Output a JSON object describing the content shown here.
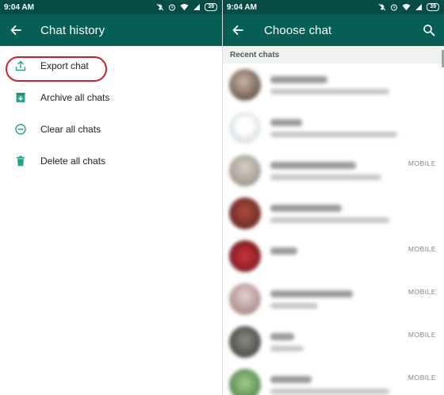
{
  "status_bar": {
    "time": "9:04 AM",
    "battery": "39"
  },
  "left": {
    "title": "Chat history",
    "menu": [
      {
        "label": "Export chat",
        "icon": "export-icon"
      },
      {
        "label": "Archive all chats",
        "icon": "archive-icon"
      },
      {
        "label": "Clear all chats",
        "icon": "clear-icon"
      },
      {
        "label": "Delete all chats",
        "icon": "delete-icon"
      }
    ]
  },
  "right": {
    "title": "Choose chat",
    "section": "Recent chats",
    "chats": [
      {
        "tag": ""
      },
      {
        "tag": ""
      },
      {
        "tag": "MOBILE"
      },
      {
        "tag": ""
      },
      {
        "tag": "MOBILE"
      },
      {
        "tag": "MOBILE"
      },
      {
        "tag": "MOBILE"
      },
      {
        "tag": "MOBILE"
      }
    ]
  },
  "colors": {
    "status_bar": "#054d44",
    "app_bar": "#075e54",
    "icon_teal": "#2aa28b",
    "highlight": "#c8242c"
  }
}
